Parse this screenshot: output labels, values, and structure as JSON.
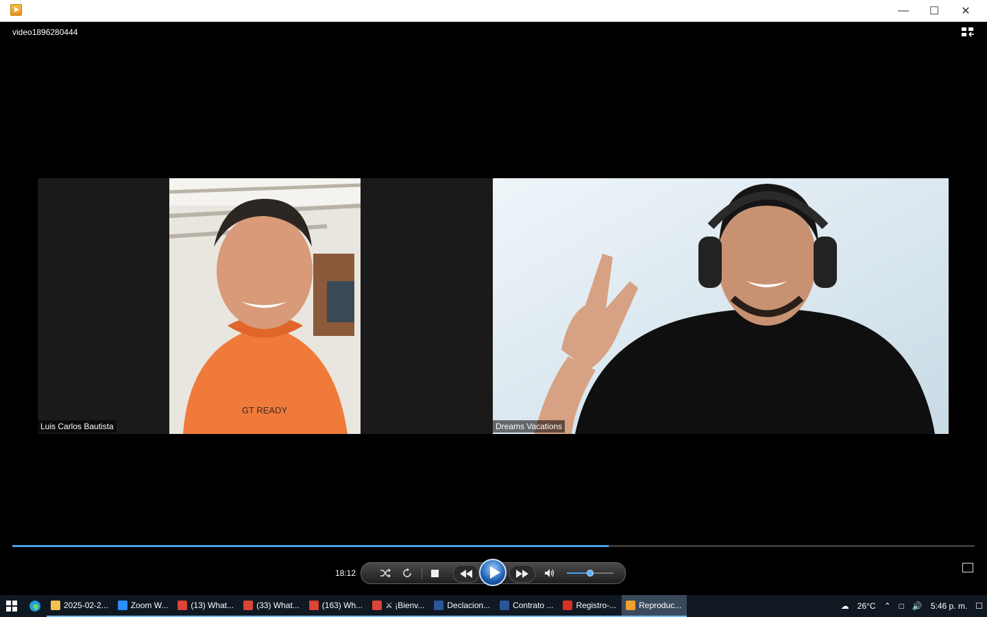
{
  "window": {
    "title": "video1896280444"
  },
  "participants": [
    {
      "name": "Luis Carlos Bautista"
    },
    {
      "name": "Dreams Vacations"
    }
  ],
  "playback": {
    "time": "18:12",
    "progress": 0.62,
    "volume": 0.5,
    "state": "paused"
  },
  "taskbar": {
    "items": [
      {
        "label": "2025-02-2...",
        "icon": "folder-icon",
        "color": "#f2c14e"
      },
      {
        "label": "Zoom W...",
        "icon": "zoom-icon",
        "color": "#2d8cff"
      },
      {
        "label": "(13) What...",
        "icon": "chrome-icon",
        "color": "#db4437"
      },
      {
        "label": "(33) What...",
        "icon": "chrome-icon",
        "color": "#db4437"
      },
      {
        "label": "(163) Wh...",
        "icon": "chrome-icon",
        "color": "#db4437"
      },
      {
        "label": "⚔ ¡Bienv...",
        "icon": "chrome-icon",
        "color": "#db4437"
      },
      {
        "label": "Declacion...",
        "icon": "word-icon",
        "color": "#2b579a"
      },
      {
        "label": "Contrato ...",
        "icon": "word-icon",
        "color": "#2b579a"
      },
      {
        "label": "Registro-...",
        "icon": "pdf-icon",
        "color": "#d93025"
      },
      {
        "label": "Reproduc...",
        "icon": "media-player-icon",
        "color": "#f0a030"
      }
    ],
    "weather": "26°C",
    "clock": "5:46 p. m."
  },
  "colors": {
    "accent": "#4aa0e8",
    "taskbar": "#101822"
  }
}
